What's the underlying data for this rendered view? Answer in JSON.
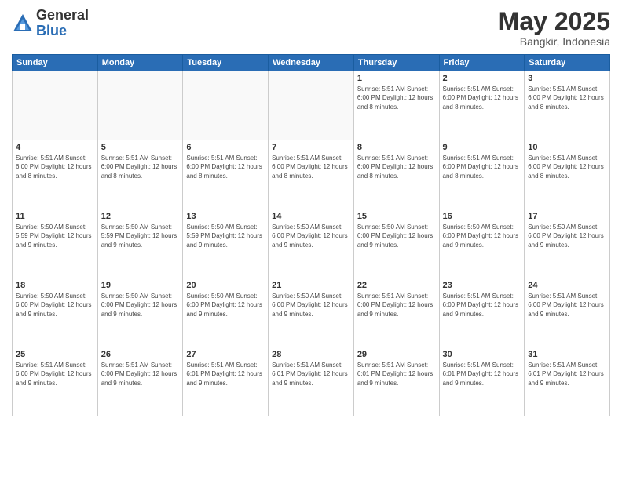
{
  "logo": {
    "general": "General",
    "blue": "Blue"
  },
  "title": "May 2025",
  "location": "Bangkir, Indonesia",
  "days_of_week": [
    "Sunday",
    "Monday",
    "Tuesday",
    "Wednesday",
    "Thursday",
    "Friday",
    "Saturday"
  ],
  "weeks": [
    [
      {
        "day": "",
        "info": ""
      },
      {
        "day": "",
        "info": ""
      },
      {
        "day": "",
        "info": ""
      },
      {
        "day": "",
        "info": ""
      },
      {
        "day": "1",
        "info": "Sunrise: 5:51 AM\nSunset: 6:00 PM\nDaylight: 12 hours\nand 8 minutes."
      },
      {
        "day": "2",
        "info": "Sunrise: 5:51 AM\nSunset: 6:00 PM\nDaylight: 12 hours\nand 8 minutes."
      },
      {
        "day": "3",
        "info": "Sunrise: 5:51 AM\nSunset: 6:00 PM\nDaylight: 12 hours\nand 8 minutes."
      }
    ],
    [
      {
        "day": "4",
        "info": "Sunrise: 5:51 AM\nSunset: 6:00 PM\nDaylight: 12 hours\nand 8 minutes."
      },
      {
        "day": "5",
        "info": "Sunrise: 5:51 AM\nSunset: 6:00 PM\nDaylight: 12 hours\nand 8 minutes."
      },
      {
        "day": "6",
        "info": "Sunrise: 5:51 AM\nSunset: 6:00 PM\nDaylight: 12 hours\nand 8 minutes."
      },
      {
        "day": "7",
        "info": "Sunrise: 5:51 AM\nSunset: 6:00 PM\nDaylight: 12 hours\nand 8 minutes."
      },
      {
        "day": "8",
        "info": "Sunrise: 5:51 AM\nSunset: 6:00 PM\nDaylight: 12 hours\nand 8 minutes."
      },
      {
        "day": "9",
        "info": "Sunrise: 5:51 AM\nSunset: 6:00 PM\nDaylight: 12 hours\nand 8 minutes."
      },
      {
        "day": "10",
        "info": "Sunrise: 5:51 AM\nSunset: 6:00 PM\nDaylight: 12 hours\nand 8 minutes."
      }
    ],
    [
      {
        "day": "11",
        "info": "Sunrise: 5:50 AM\nSunset: 5:59 PM\nDaylight: 12 hours\nand 9 minutes."
      },
      {
        "day": "12",
        "info": "Sunrise: 5:50 AM\nSunset: 5:59 PM\nDaylight: 12 hours\nand 9 minutes."
      },
      {
        "day": "13",
        "info": "Sunrise: 5:50 AM\nSunset: 5:59 PM\nDaylight: 12 hours\nand 9 minutes."
      },
      {
        "day": "14",
        "info": "Sunrise: 5:50 AM\nSunset: 6:00 PM\nDaylight: 12 hours\nand 9 minutes."
      },
      {
        "day": "15",
        "info": "Sunrise: 5:50 AM\nSunset: 6:00 PM\nDaylight: 12 hours\nand 9 minutes."
      },
      {
        "day": "16",
        "info": "Sunrise: 5:50 AM\nSunset: 6:00 PM\nDaylight: 12 hours\nand 9 minutes."
      },
      {
        "day": "17",
        "info": "Sunrise: 5:50 AM\nSunset: 6:00 PM\nDaylight: 12 hours\nand 9 minutes."
      }
    ],
    [
      {
        "day": "18",
        "info": "Sunrise: 5:50 AM\nSunset: 6:00 PM\nDaylight: 12 hours\nand 9 minutes."
      },
      {
        "day": "19",
        "info": "Sunrise: 5:50 AM\nSunset: 6:00 PM\nDaylight: 12 hours\nand 9 minutes."
      },
      {
        "day": "20",
        "info": "Sunrise: 5:50 AM\nSunset: 6:00 PM\nDaylight: 12 hours\nand 9 minutes."
      },
      {
        "day": "21",
        "info": "Sunrise: 5:50 AM\nSunset: 6:00 PM\nDaylight: 12 hours\nand 9 minutes."
      },
      {
        "day": "22",
        "info": "Sunrise: 5:51 AM\nSunset: 6:00 PM\nDaylight: 12 hours\nand 9 minutes."
      },
      {
        "day": "23",
        "info": "Sunrise: 5:51 AM\nSunset: 6:00 PM\nDaylight: 12 hours\nand 9 minutes."
      },
      {
        "day": "24",
        "info": "Sunrise: 5:51 AM\nSunset: 6:00 PM\nDaylight: 12 hours\nand 9 minutes."
      }
    ],
    [
      {
        "day": "25",
        "info": "Sunrise: 5:51 AM\nSunset: 6:00 PM\nDaylight: 12 hours\nand 9 minutes."
      },
      {
        "day": "26",
        "info": "Sunrise: 5:51 AM\nSunset: 6:00 PM\nDaylight: 12 hours\nand 9 minutes."
      },
      {
        "day": "27",
        "info": "Sunrise: 5:51 AM\nSunset: 6:01 PM\nDaylight: 12 hours\nand 9 minutes."
      },
      {
        "day": "28",
        "info": "Sunrise: 5:51 AM\nSunset: 6:01 PM\nDaylight: 12 hours\nand 9 minutes."
      },
      {
        "day": "29",
        "info": "Sunrise: 5:51 AM\nSunset: 6:01 PM\nDaylight: 12 hours\nand 9 minutes."
      },
      {
        "day": "30",
        "info": "Sunrise: 5:51 AM\nSunset: 6:01 PM\nDaylight: 12 hours\nand 9 minutes."
      },
      {
        "day": "31",
        "info": "Sunrise: 5:51 AM\nSunset: 6:01 PM\nDaylight: 12 hours\nand 9 minutes."
      }
    ]
  ]
}
